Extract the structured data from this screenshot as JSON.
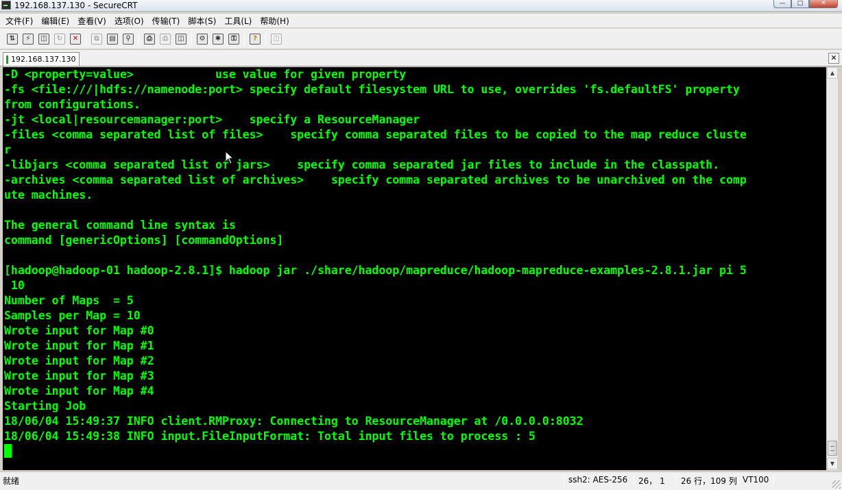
{
  "window": {
    "title": "192.168.137.130 - SecureCRT",
    "buttons": [
      "minimize",
      "maximize",
      "close"
    ]
  },
  "menu": [
    "文件(F)",
    "编辑(E)",
    "查看(V)",
    "选项(O)",
    "传输(T)",
    "脚本(S)",
    "工具(L)",
    "帮助(H)"
  ],
  "toolbar": {
    "groups": [
      [
        "connect-icon",
        "quick-connect-icon",
        "connect-tab-icon",
        "reconnect-icon",
        "disconnect-icon"
      ],
      [
        "copy-icon",
        "paste-icon",
        "find-icon"
      ],
      [
        "print-icon",
        "print-selection-icon",
        "print-setup-icon"
      ],
      [
        "session-options-icon",
        "global-options-icon",
        "key-generate-icon"
      ],
      [
        "help-icon"
      ],
      [
        "sftp-icon"
      ]
    ]
  },
  "tabs": [
    {
      "label": "192.168.137.130",
      "status": "connected"
    }
  ],
  "terminal": {
    "lines": [
      "-D <property=value>            use value for given property",
      "-fs <file:///|hdfs://namenode:port> specify default filesystem URL to use, overrides 'fs.defaultFS' property",
      "from configurations.",
      "-jt <local|resourcemanager:port>    specify a ResourceManager",
      "-files <comma separated list of files>    specify comma separated files to be copied to the map reduce cluste",
      "r",
      "-libjars <comma separated list of jars>    specify comma separated jar files to include in the classpath.",
      "-archives <comma separated list of archives>    specify comma separated archives to be unarchived on the comp",
      "ute machines.",
      "",
      "The general command line syntax is",
      "command [genericOptions] [commandOptions]",
      "",
      "[hadoop@hadoop-01 hadoop-2.8.1]$ hadoop jar ./share/hadoop/mapreduce/hadoop-mapreduce-examples-2.8.1.jar pi 5",
      " 10",
      "Number of Maps  = 5",
      "Samples per Map = 10",
      "Wrote input for Map #0",
      "Wrote input for Map #1",
      "Wrote input for Map #2",
      "Wrote input for Map #3",
      "Wrote input for Map #4",
      "Starting Job",
      "18/06/04 15:49:37 INFO client.RMProxy: Connecting to ResourceManager at /0.0.0.0:8032",
      "18/06/04 15:49:38 INFO input.FileInputFormat: Total input files to process : 5"
    ],
    "text_color": "#00ff00",
    "background": "#000000"
  },
  "statusbar": {
    "ready": "就绪",
    "protocol": "ssh2: AES-256",
    "cursor_pos": "26，  1",
    "size": "26 行，109 列",
    "emulation": "VT100"
  }
}
